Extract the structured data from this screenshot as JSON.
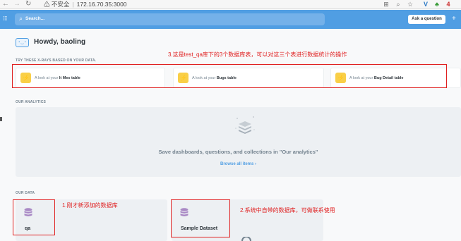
{
  "browser": {
    "back_icon": "arrow-left-icon",
    "forward_icon": "arrow-right-icon",
    "reload_icon": "reload-icon",
    "security_label": "不安全",
    "url": "172.16.70.35:3000",
    "badge_count": "4"
  },
  "app": {
    "search_placeholder": "Search...",
    "ask_button": "Ask a question",
    "plus": "+"
  },
  "greeting": "Howdy, baoling",
  "xrays": {
    "heading": "TRY THESE X-RAYS BASED ON YOUR DATA.",
    "prefix": "A look at your",
    "items": [
      {
        "table": "It Mes table"
      },
      {
        "table": "Bugs table"
      },
      {
        "table": "Bug Detail table"
      }
    ]
  },
  "analytics": {
    "heading": "OUR ANALYTICS",
    "empty_text": "Save dashboards, questions, and collections in \"Our analytics\"",
    "browse_link": "Browse all items",
    "chevron": "›"
  },
  "data": {
    "heading": "OUR DATA",
    "databases": [
      {
        "name": "qa"
      },
      {
        "name": "Sample Dataset"
      }
    ]
  },
  "annotations": {
    "note_tables": "3.这是test_qa库下的3个数据库表，可以对这三个表进行数据统计的操作",
    "note_qa": "1.刚才新添加的数据库",
    "note_sample": "2.系统中自带的数据库，可做联系使用"
  },
  "colors": {
    "brand": "#509ee3",
    "annotation_red": "#e02020",
    "xray_bolt": "#f9cf48",
    "db_icon": "#a989c5"
  }
}
